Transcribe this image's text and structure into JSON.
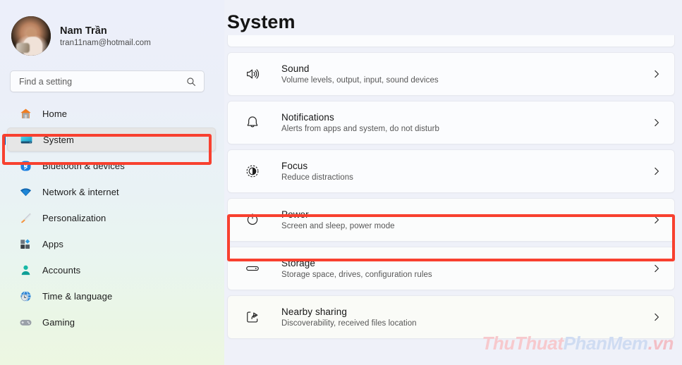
{
  "window": {
    "app_name": "Settings"
  },
  "profile": {
    "name": "Nam Trần",
    "email": "tran11nam@hotmail.com",
    "avatar_icon": "user-photo-avatar"
  },
  "search": {
    "placeholder": "Find a setting",
    "value": "",
    "icon": "search-icon"
  },
  "sidebar": {
    "items": [
      {
        "label": "Home",
        "icon": "home-icon",
        "selected": false
      },
      {
        "label": "System",
        "icon": "monitor-icon",
        "selected": true
      },
      {
        "label": "Bluetooth & devices",
        "icon": "bluetooth-icon",
        "selected": false
      },
      {
        "label": "Network & internet",
        "icon": "wifi-icon",
        "selected": false
      },
      {
        "label": "Personalization",
        "icon": "paintbrush-icon",
        "selected": false
      },
      {
        "label": "Apps",
        "icon": "apps-grid-icon",
        "selected": false
      },
      {
        "label": "Accounts",
        "icon": "person-icon",
        "selected": false
      },
      {
        "label": "Time & language",
        "icon": "clock-globe-icon",
        "selected": false
      },
      {
        "label": "Gaming",
        "icon": "gamepad-icon",
        "selected": false
      }
    ]
  },
  "main": {
    "title": "System",
    "cards": [
      {
        "title": "Sound",
        "subtitle": "Volume levels, output, input, sound devices",
        "icon": "speaker-icon",
        "chevron": "chevron-right-icon"
      },
      {
        "title": "Notifications",
        "subtitle": "Alerts from apps and system, do not disturb",
        "icon": "bell-icon",
        "chevron": "chevron-right-icon"
      },
      {
        "title": "Focus",
        "subtitle": "Reduce distractions",
        "icon": "focus-icon",
        "chevron": "chevron-right-icon"
      },
      {
        "title": "Power",
        "subtitle": "Screen and sleep, power mode",
        "icon": "power-icon",
        "chevron": "chevron-right-icon"
      },
      {
        "title": "Storage",
        "subtitle": "Storage space, drives, configuration rules",
        "icon": "drive-icon",
        "chevron": "chevron-right-icon"
      },
      {
        "title": "Nearby sharing",
        "subtitle": "Discoverability, received files location",
        "icon": "share-icon",
        "chevron": "chevron-right-icon"
      }
    ]
  },
  "annotations": {
    "color": "#f8402f",
    "targets": [
      "sidebar-item-system",
      "card-power"
    ]
  },
  "watermark": {
    "part1": "ThuThuat",
    "part2": "PhanMem",
    "part3": ".vn",
    "color1": "#f7c9cd",
    "color2": "#cfdcf2",
    "color3": "#f3bfc6"
  }
}
